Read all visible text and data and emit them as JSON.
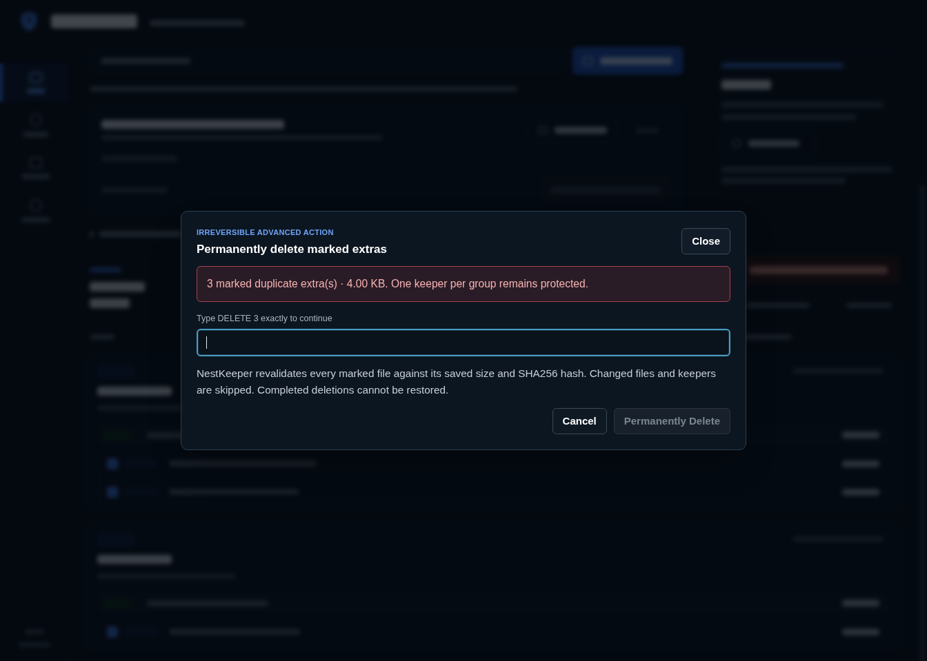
{
  "modal": {
    "eyebrow": "IRREVERSIBLE ADVANCED ACTION",
    "title": "Permanently delete marked extras",
    "close_button": "Close",
    "warning": "3 marked duplicate extra(s) · 4.00 KB. One keeper per group remains protected.",
    "input": {
      "label": "Type DELETE 3 exactly to continue",
      "focused": true
    },
    "description": "NestKeeper revalidates every marked file against its saved size and SHA256 hash. Changed files and keepers are skipped. Completed deletions cannot be restored.",
    "buttons": [
      {
        "kind": "secondary",
        "label": "Cancel",
        "disabled": false
      },
      {
        "kind": "danger",
        "label": "Permanently Delete",
        "disabled": true
      }
    ]
  }
}
